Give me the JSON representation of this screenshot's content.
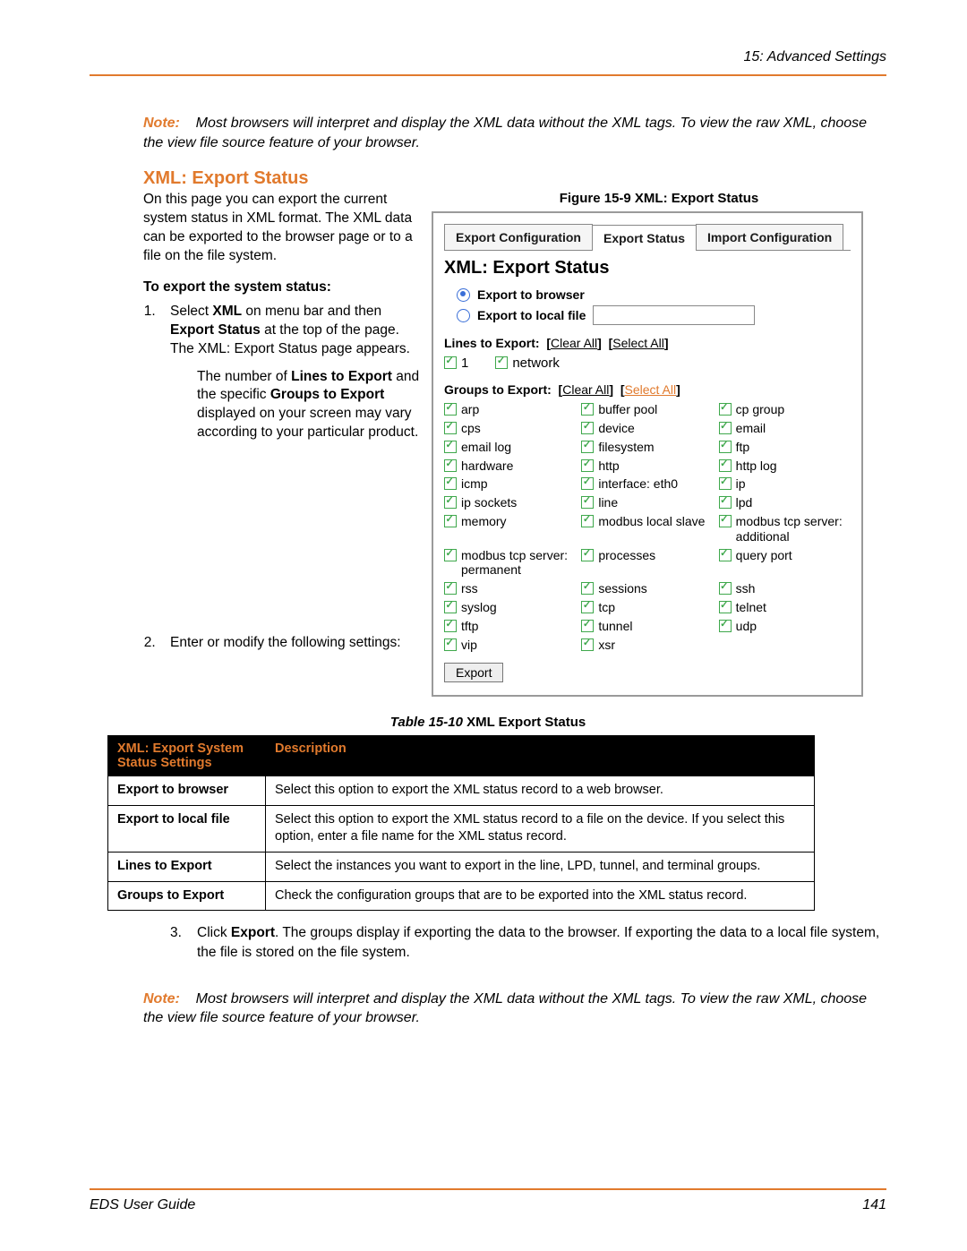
{
  "header": {
    "breadcrumb": "15: Advanced Settings"
  },
  "note1": {
    "label": "Note:",
    "text": "Most browsers will interpret and display the XML data without the XML tags. To view the raw XML, choose the view file source feature of your browser."
  },
  "section": {
    "title": "XML: Export Status",
    "intro": "On this page you can export the current system status in XML format. The XML data can be exported to the browser page or to a file on the file system.",
    "subhead": "To export the system status:",
    "step1a": "Select ",
    "step1b": "XML",
    "step1c": " on menu bar and then ",
    "step1d": "Export Status",
    "step1e": " at the top of the page. The XML: Export Status page appears.",
    "step1para2a": "The number of ",
    "step1para2b": "Lines to Export",
    "step1para2c": " and the specific ",
    "step1para2d": "Groups to Export",
    "step1para2e": " displayed on your screen may vary according to your particular product.",
    "step2": "Enter or modify the following settings:"
  },
  "figure": {
    "caption": "Figure 15-9  XML: Export Status",
    "tabs": [
      "Export Configuration",
      "Export Status",
      "Import Configuration"
    ],
    "active_tab": 1,
    "heading": "XML: Export Status",
    "radios": {
      "browser": "Export to browser",
      "localfile": "Export to local file"
    },
    "lines_label": "Lines to Export:",
    "clear_all": "Clear All",
    "select_all": "Select All",
    "lines": [
      "1",
      "network"
    ],
    "groups_label": "Groups to Export:",
    "groups": [
      "arp",
      "buffer pool",
      "cp group",
      "cps",
      "device",
      "email",
      "email log",
      "filesystem",
      "ftp",
      "hardware",
      "http",
      "http log",
      "icmp",
      "interface: eth0",
      "ip",
      "ip sockets",
      "line",
      "lpd",
      "memory",
      "modbus local slave",
      "modbus tcp server: additional",
      "modbus tcp server: permanent",
      "processes",
      "query port",
      "rss",
      "sessions",
      "ssh",
      "syslog",
      "tcp",
      "telnet",
      "tftp",
      "tunnel",
      "udp",
      "vip",
      "xsr"
    ],
    "export_btn": "Export"
  },
  "table": {
    "caption_label": "Table 15-10",
    "caption_title": " XML Export Status",
    "col1": "XML: Export System Status Settings",
    "col2": "Description",
    "rows": [
      {
        "setting": "Export to browser",
        "desc": "Select this option to export the XML status record to a web browser."
      },
      {
        "setting": "Export to local file",
        "desc": "Select this option to export the XML status record to a file on the device. If you select this option, enter a file name for the XML status record."
      },
      {
        "setting": "Lines to Export",
        "desc": "Select the instances you want to export in the line, LPD,  tunnel, and terminal groups."
      },
      {
        "setting": "Groups to Export",
        "desc": "Check the configuration groups that are to be exported into the XML status record."
      }
    ]
  },
  "step3": {
    "num": "3.",
    "a": "Click ",
    "b": "Export",
    "c": ". The groups display if exporting the data to the browser. If exporting the data to a local file system, the file is stored on the file system."
  },
  "note2": {
    "label": "Note:",
    "text": "Most browsers will interpret and display the XML data without the XML tags. To view the raw XML, choose the view file source feature of your browser."
  },
  "footer": {
    "guide": "EDS User Guide",
    "page": "141"
  }
}
